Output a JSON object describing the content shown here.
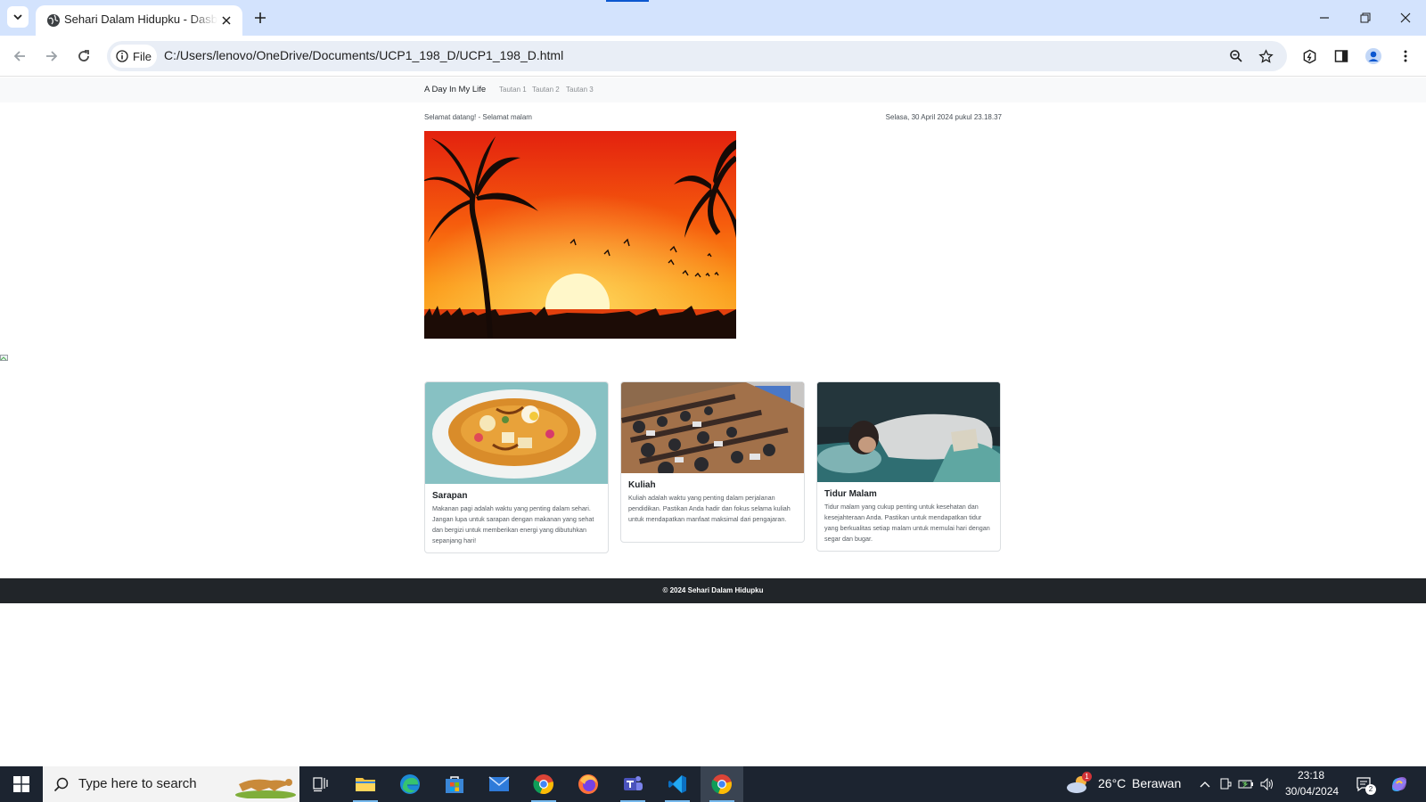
{
  "browser": {
    "tab_title": "Sehari Dalam Hidupku - Dasbor",
    "chip_label": "File",
    "url": "C:/Users/lenovo/OneDrive/Documents/UCP1_198_D/UCP1_198_D.html"
  },
  "site": {
    "brand": "A Day In My Life",
    "nav_links": [
      "Tautan 1",
      "Tautan 2",
      "Tautan 3"
    ],
    "greeting": "Selamat datang! - Selamat malam",
    "datetime": "Selasa, 30 April 2024 pukul 23.18.37",
    "cards": [
      {
        "title": "Sarapan",
        "text": "Makanan pagi adalah waktu yang penting dalam sehari. Jangan lupa untuk sarapan dengan makanan yang sehat dan bergizi untuk memberikan energi yang dibutuhkan sepanjang hari!"
      },
      {
        "title": "Kuliah",
        "text": "Kuliah adalah waktu yang penting dalam perjalanan pendidikan. Pastikan Anda hadir dan fokus selama kuliah untuk mendapatkan manfaat maksimal dari pengajaran."
      },
      {
        "title": "Tidur Malam",
        "text": "Tidur malam yang cukup penting untuk kesehatan dan kesejahteraan Anda. Pastikan untuk mendapatkan tidur yang berkualitas setiap malam untuk memulai hari dengan segar dan bugar."
      }
    ],
    "footer": "© 2024 Sehari Dalam Hidupku"
  },
  "taskbar": {
    "search_placeholder": "Type here to search",
    "weather_temp": "26°C",
    "weather_desc": "Berawan",
    "weather_badge": "1",
    "time": "23:18",
    "date": "30/04/2024",
    "notification_count": "2"
  },
  "colors": {
    "tabbar": "#d3e3fd",
    "navbar": "#f8f9fa",
    "footer": "#212529",
    "taskbar": "#1c2430"
  }
}
